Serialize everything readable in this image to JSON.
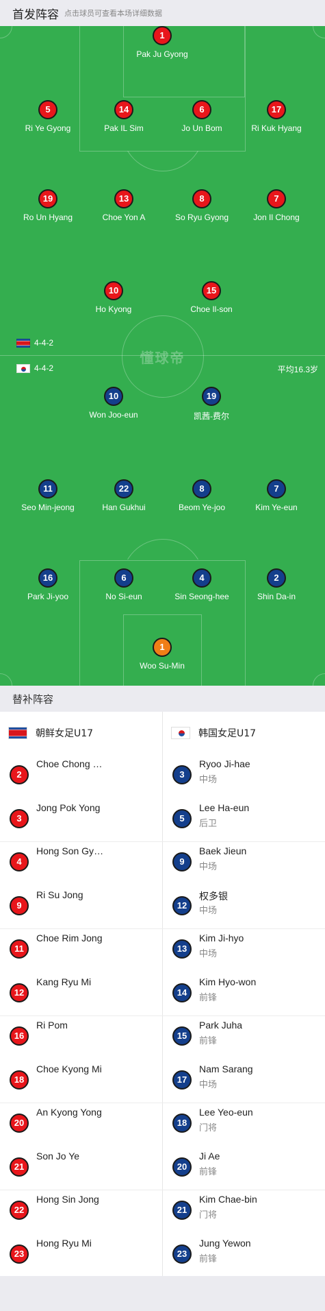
{
  "header": {
    "title": "首发阵容",
    "hint": "点击球员可查看本场详细数据"
  },
  "pitch": {
    "watermark": "懂球帝",
    "home_formation": "4-4-2",
    "away_formation": "4-4-2",
    "away_avg_age": "平均16.3岁"
  },
  "home_lineup": [
    {
      "number": "1",
      "name": "Pak Ju Gyong"
    },
    {
      "number": "5",
      "name": "Ri Ye Gyong"
    },
    {
      "number": "14",
      "name": "Pak IL Sim"
    },
    {
      "number": "6",
      "name": "Jo Un Bom"
    },
    {
      "number": "17",
      "name": "Ri Kuk Hyang"
    },
    {
      "number": "19",
      "name": "Ro Un Hyang"
    },
    {
      "number": "13",
      "name": "Choe Yon A"
    },
    {
      "number": "8",
      "name": "So Ryu Gyong"
    },
    {
      "number": "7",
      "name": "Jon Il Chong"
    },
    {
      "number": "10",
      "name": "Ho Kyong"
    },
    {
      "number": "15",
      "name": "Choe Il-son"
    }
  ],
  "away_lineup": [
    {
      "number": "10",
      "name": "Won Joo-eun"
    },
    {
      "number": "19",
      "name": "凯茜-费尔"
    },
    {
      "number": "11",
      "name": "Seo Min-jeong"
    },
    {
      "number": "22",
      "name": "Han Gukhui"
    },
    {
      "number": "8",
      "name": "Beom Ye-joo"
    },
    {
      "number": "7",
      "name": "Kim Ye-eun"
    },
    {
      "number": "16",
      "name": "Park Ji-yoo"
    },
    {
      "number": "6",
      "name": "No Si-eun"
    },
    {
      "number": "4",
      "name": "Sin Seong-hee"
    },
    {
      "number": "2",
      "name": "Shin Da-in"
    },
    {
      "number": "1",
      "name": "Woo Su-Min"
    }
  ],
  "subs": {
    "title": "替补阵容",
    "home_team": "朝鲜女足U17",
    "away_team": "韩国女足U17",
    "home": [
      {
        "number": "2",
        "name": "Choe Chong Gyong"
      },
      {
        "number": "3",
        "name": "Jong Pok Yong"
      },
      {
        "number": "4",
        "name": "Hong Son Gyong"
      },
      {
        "number": "9",
        "name": "Ri Su Jong"
      },
      {
        "number": "11",
        "name": "Choe Rim Jong"
      },
      {
        "number": "12",
        "name": "Kang Ryu Mi"
      },
      {
        "number": "16",
        "name": "Ri Pom"
      },
      {
        "number": "18",
        "name": "Choe Kyong Mi"
      },
      {
        "number": "20",
        "name": "An Kyong Yong"
      },
      {
        "number": "21",
        "name": "Son Jo Ye"
      },
      {
        "number": "22",
        "name": "Hong Sin Jong"
      },
      {
        "number": "23",
        "name": "Hong Ryu Mi"
      }
    ],
    "away": [
      {
        "number": "3",
        "name": "Ryoo Ji-hae",
        "position": "中场"
      },
      {
        "number": "5",
        "name": "Lee Ha-eun",
        "position": "后卫"
      },
      {
        "number": "9",
        "name": "Baek Jieun",
        "position": "中场"
      },
      {
        "number": "12",
        "name": "权多银",
        "position": "中场"
      },
      {
        "number": "13",
        "name": "Kim Ji-hyo",
        "position": "中场"
      },
      {
        "number": "14",
        "name": "Kim Hyo-won",
        "position": "前锋"
      },
      {
        "number": "15",
        "name": "Park Juha",
        "position": "前锋"
      },
      {
        "number": "17",
        "name": "Nam Sarang",
        "position": "中场"
      },
      {
        "number": "18",
        "name": "Lee Yeo-eun",
        "position": "门将"
      },
      {
        "number": "20",
        "name": "Ji Ae",
        "position": "前锋"
      },
      {
        "number": "21",
        "name": "Kim Chae-bin",
        "position": "门将"
      },
      {
        "number": "23",
        "name": "Jung Yewon",
        "position": "前锋"
      }
    ]
  },
  "colors": {
    "pitch": "#34ae4f",
    "home_badge": "#e8161b",
    "away_badge": "#143f8c",
    "goalkeeper_badge": "#f07e16"
  }
}
